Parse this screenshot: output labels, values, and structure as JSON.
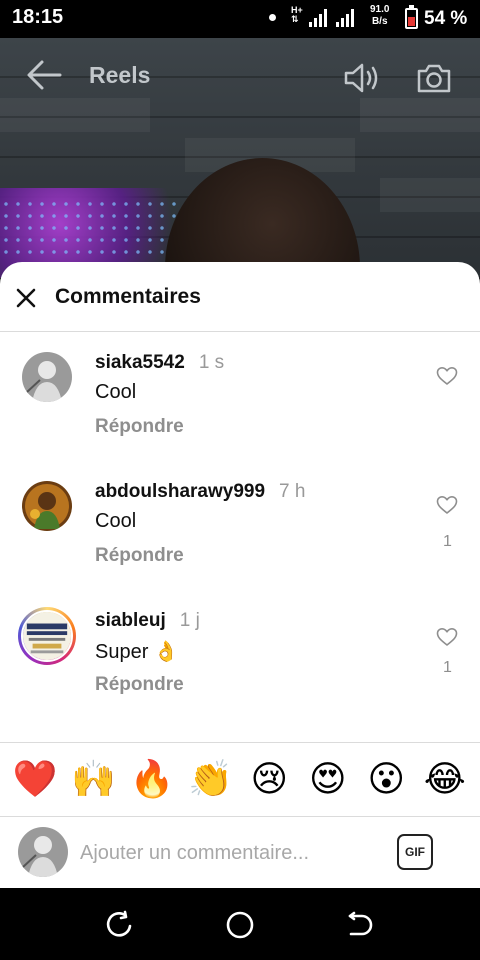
{
  "status_bar": {
    "time": "18:15",
    "network_type": "H+",
    "speed_value": "91.0",
    "speed_unit": "B/s",
    "battery_percent": "54 %"
  },
  "reel_header": {
    "title": "Reels",
    "icons": [
      "back-arrow-icon",
      "speaker-icon",
      "camera-icon"
    ]
  },
  "sheet": {
    "title": "Commentaires",
    "comments": [
      {
        "username": "siaka5542",
        "time": "1 s",
        "text": "Cool",
        "reply_label": "Répondre",
        "likes": ""
      },
      {
        "username": "abdoulsharawy999",
        "time": "7 h",
        "text": "Cool",
        "reply_label": "Répondre",
        "likes": "1"
      },
      {
        "username": "siableuj",
        "time": "1 j",
        "text": "Super 👌",
        "reply_label": "Répondre",
        "likes": "1"
      }
    ],
    "emojis": [
      "❤️",
      "🙌",
      "🔥",
      "👏",
      "😢",
      "😍",
      "😮",
      "😂"
    ],
    "input_placeholder": "Ajouter un commentaire...",
    "gif_label": "GIF"
  },
  "colors": {
    "accent_text": "#111111",
    "muted_text": "#8e8e8e",
    "divider": "#dbdbdb",
    "battery_low": "#e53935"
  }
}
